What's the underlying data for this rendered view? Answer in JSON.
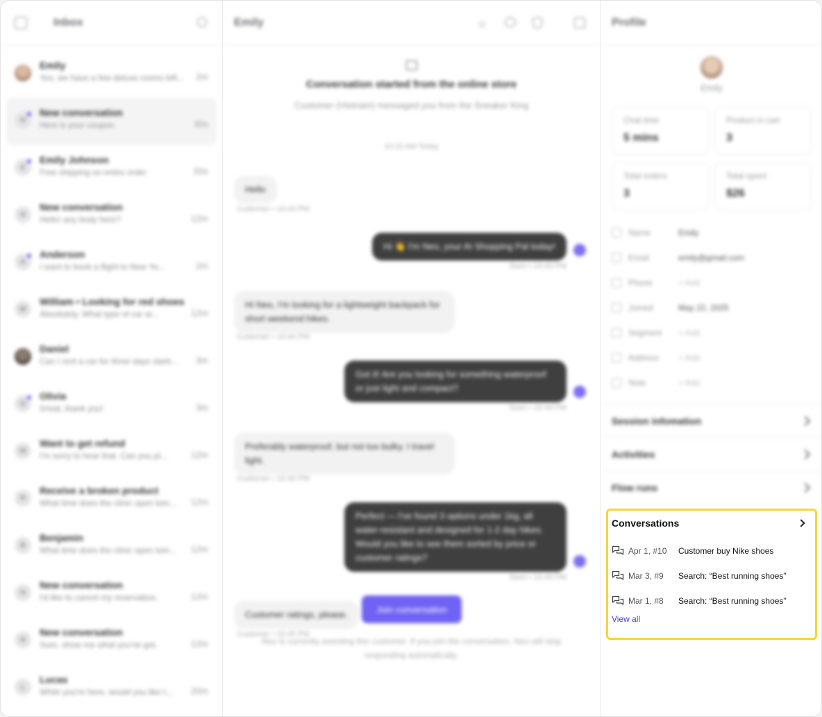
{
  "inbox": {
    "title": "Inbox",
    "conversations": [
      {
        "name": "Emily",
        "preview": "Yes, we have a few deluxe rooms left...",
        "time": "2m",
        "initial": ""
      },
      {
        "name": "New conversation",
        "preview": "Here is your coupon",
        "time": "30s",
        "initial": "N"
      },
      {
        "name": "Emily Johnson",
        "preview": "Free shipping on entire order",
        "time": "50s",
        "initial": "E"
      },
      {
        "name": "New conversation",
        "preview": "Hello! any body here?",
        "time": "12m",
        "initial": "N"
      },
      {
        "name": "Anderson",
        "preview": "I want to book a flight to New Yo...",
        "time": "2m",
        "initial": "A"
      },
      {
        "name": "William • Looking for red shoes",
        "preview": "Absolutely. What type of car ar...",
        "time": "12m",
        "initial": "W"
      },
      {
        "name": "Daniel",
        "preview": "Can I rent a car for three days starti...",
        "time": "3m",
        "initial": ""
      },
      {
        "name": "Olivia",
        "preview": "Great, thank you!",
        "time": "3m",
        "initial": "O"
      },
      {
        "name": "Want to get refund",
        "preview": "I'm sorry to hear that. Can you pl...",
        "time": "12m",
        "initial": "W"
      },
      {
        "name": "Receive a broken product",
        "preview": "What time does the clinic open tom...",
        "time": "12m",
        "initial": "R"
      },
      {
        "name": "Benjamin",
        "preview": "What time does the clinic open tom...",
        "time": "12m",
        "initial": "B"
      },
      {
        "name": "New conversation",
        "preview": "I'd like to cancel my reservation.",
        "time": "12m",
        "initial": "N"
      },
      {
        "name": "New conversation",
        "preview": "Sure, show me what you've got.",
        "time": "12m",
        "initial": "N"
      },
      {
        "name": "Lucas",
        "preview": "While you're here, would you like t...",
        "time": "20m",
        "initial": "L"
      }
    ]
  },
  "chat": {
    "contact": "Emily",
    "started_title": "Conversation started from the online store",
    "started_sub": "Customer (Vietnam) messaged you from the Sneaker King",
    "date": "10:15 AM Today",
    "messages": [
      {
        "text": "Hello",
        "meta": "Customer • 10:43 PM"
      },
      {
        "text": "Hi 👋 I'm Neo, your AI Shopping Pal today!",
        "meta": "Seen • 10:43 PM"
      },
      {
        "text": "Hi Neo, I'm looking for a lightweight backpack for short weekend hikes.",
        "meta": "Customer • 10:44 PM"
      },
      {
        "text": "Got it! Are you looking for something waterproof or just light and compact?",
        "meta": "Seen • 10:44 PM"
      },
      {
        "text": "Preferably waterproof, but not too bulky. I travel light.",
        "meta": "Customer • 10:44 PM"
      },
      {
        "text": "Perfect — I've found 3 options under 1kg, all water-resistant and designed for 1-2 day hikes. Would you like to see them sorted by price or customer ratings?",
        "meta": "Seen • 10:44 PM"
      },
      {
        "text": "Customer ratings, please.",
        "meta": "Customer • 10:45 PM"
      }
    ],
    "join_label": "Join conversation",
    "note": "Neo is currently assisting this customer. If you join the conversation, Neo will stop responding automatically."
  },
  "profile": {
    "title": "Profile",
    "name": "Emily",
    "stats": [
      {
        "label": "Chat time",
        "value": "5 mins"
      },
      {
        "label": "Product in cart",
        "value": "3"
      },
      {
        "label": "Total orders",
        "value": "3"
      },
      {
        "label": "Total spent",
        "value": "$26"
      }
    ],
    "fields": [
      {
        "label": "Name",
        "value": "Emily"
      },
      {
        "label": "Email",
        "value": "emily@gmail.com"
      },
      {
        "label": "Phone",
        "value": "+ Add"
      },
      {
        "label": "Joined",
        "value": "May 22, 2025"
      },
      {
        "label": "Segment",
        "value": "+ Add"
      },
      {
        "label": "Address",
        "value": "+ Add"
      },
      {
        "label": "Note",
        "value": "+ Add"
      }
    ],
    "sections": [
      "Session infomation",
      "Activities",
      "Flow runs"
    ],
    "conversations": {
      "title": "Conversations",
      "items": [
        {
          "date": "Apr 1, #10",
          "title": "Customer buy Nike shoes"
        },
        {
          "date": "Mar 3, #9",
          "title": "Search: “Best running shoes”"
        },
        {
          "date": "Mar 1, #8",
          "title": "Search: “Best running shoes”"
        }
      ],
      "view_all": "View all"
    }
  },
  "colors": {
    "accent": "#6f62f4",
    "highlight": "#f5d63d",
    "link": "#4b3fe0"
  }
}
